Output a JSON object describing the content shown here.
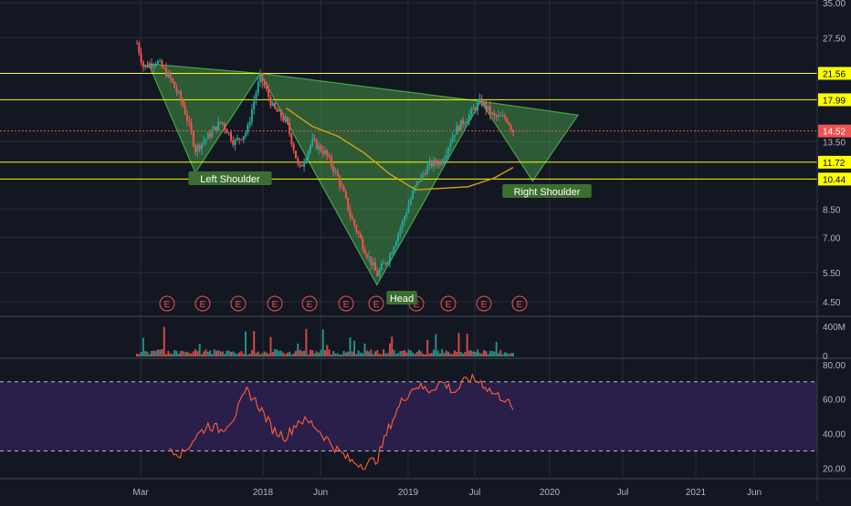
{
  "colors": {
    "background": "#131722",
    "grid": "#2a2e39",
    "axis_text": "#b2b5be",
    "up": "#26a69a",
    "down": "#ef5350",
    "level_line": "#ffff00",
    "pattern_fill": "#4caf50",
    "moving_average": "#d4a017",
    "rsi_line": "#ff5e3a",
    "rsi_band": "#2a1f4a",
    "earnings": "#ef5350",
    "label_bg": "#3c6e2f",
    "last_price": "#ef5350"
  },
  "chart_data": [
    {
      "type": "candlestick",
      "panel": "price",
      "log_scale": true,
      "ylim": [
        4.2,
        35
      ],
      "y_ticks": [
        35.0,
        27.5,
        13.5,
        8.5,
        7.0,
        5.5,
        4.5
      ],
      "x_tick_labels": [
        "Mar",
        "2018",
        "Jun",
        "2019",
        "Jul",
        "2020",
        "Jul",
        "2021",
        "Jun"
      ],
      "horizontal_levels": [
        21.56,
        17.99,
        11.72,
        10.44
      ],
      "last_price": 14.52,
      "annotations": [
        "Left Shoulder",
        "Head",
        "Right Shoulder"
      ],
      "earnings_marker": "E",
      "earnings_count": 12,
      "price_path": [
        {
          "t": 0,
          "v": 26.5
        },
        {
          "t": 1,
          "v": 22.5
        },
        {
          "t": 3,
          "v": 23.5
        },
        {
          "t": 5,
          "v": 21.0
        },
        {
          "t": 7,
          "v": 17.5
        },
        {
          "t": 9,
          "v": 12.8
        },
        {
          "t": 11,
          "v": 14.0
        },
        {
          "t": 13,
          "v": 15.5
        },
        {
          "t": 15,
          "v": 13.4
        },
        {
          "t": 17,
          "v": 14.5
        },
        {
          "t": 19,
          "v": 21.0
        },
        {
          "t": 21,
          "v": 17.0
        },
        {
          "t": 23,
          "v": 15.5
        },
        {
          "t": 25,
          "v": 11.0
        },
        {
          "t": 27,
          "v": 13.5
        },
        {
          "t": 29,
          "v": 12.5
        },
        {
          "t": 31,
          "v": 10.5
        },
        {
          "t": 33,
          "v": 8.0
        },
        {
          "t": 35,
          "v": 6.5
        },
        {
          "t": 37,
          "v": 5.4
        },
        {
          "t": 39,
          "v": 6.2
        },
        {
          "t": 41,
          "v": 7.8
        },
        {
          "t": 43,
          "v": 10.0
        },
        {
          "t": 45,
          "v": 11.5
        },
        {
          "t": 47,
          "v": 11.8
        },
        {
          "t": 49,
          "v": 14.5
        },
        {
          "t": 51,
          "v": 16.0
        },
        {
          "t": 53,
          "v": 17.8
        },
        {
          "t": 55,
          "v": 16.0
        },
        {
          "t": 57,
          "v": 15.8
        },
        {
          "t": 58,
          "v": 14.52
        }
      ],
      "moving_average": [
        {
          "t": 23,
          "v": 17.0
        },
        {
          "t": 27,
          "v": 15.0
        },
        {
          "t": 31,
          "v": 14.0
        },
        {
          "t": 35,
          "v": 12.5
        },
        {
          "t": 39,
          "v": 10.8
        },
        {
          "t": 43,
          "v": 9.7
        },
        {
          "t": 47,
          "v": 9.8
        },
        {
          "t": 51,
          "v": 9.9
        },
        {
          "t": 55,
          "v": 10.5
        },
        {
          "t": 58,
          "v": 11.3
        }
      ]
    },
    {
      "type": "bar",
      "panel": "volume",
      "y_ticks_labels": [
        "400M",
        "0"
      ],
      "ylim": [
        0,
        400
      ]
    },
    {
      "type": "line",
      "panel": "rsi",
      "ylim": [
        15,
        82
      ],
      "y_ticks": [
        80.0,
        60.0,
        40.0,
        20.0
      ],
      "bands": [
        70,
        30
      ],
      "values": [
        {
          "t": 5,
          "v": 32
        },
        {
          "t": 7,
          "v": 28
        },
        {
          "t": 9,
          "v": 38
        },
        {
          "t": 11,
          "v": 45
        },
        {
          "t": 13,
          "v": 42
        },
        {
          "t": 15,
          "v": 50
        },
        {
          "t": 17,
          "v": 65
        },
        {
          "t": 19,
          "v": 55
        },
        {
          "t": 21,
          "v": 42
        },
        {
          "t": 23,
          "v": 38
        },
        {
          "t": 25,
          "v": 48
        },
        {
          "t": 27,
          "v": 46
        },
        {
          "t": 29,
          "v": 38
        },
        {
          "t": 31,
          "v": 30
        },
        {
          "t": 33,
          "v": 24
        },
        {
          "t": 35,
          "v": 22
        },
        {
          "t": 37,
          "v": 25
        },
        {
          "t": 39,
          "v": 45
        },
        {
          "t": 41,
          "v": 60
        },
        {
          "t": 43,
          "v": 68
        },
        {
          "t": 45,
          "v": 65
        },
        {
          "t": 47,
          "v": 70
        },
        {
          "t": 49,
          "v": 64
        },
        {
          "t": 51,
          "v": 72
        },
        {
          "t": 53,
          "v": 70
        },
        {
          "t": 55,
          "v": 63
        },
        {
          "t": 57,
          "v": 60
        },
        {
          "t": 58,
          "v": 52
        }
      ]
    }
  ]
}
